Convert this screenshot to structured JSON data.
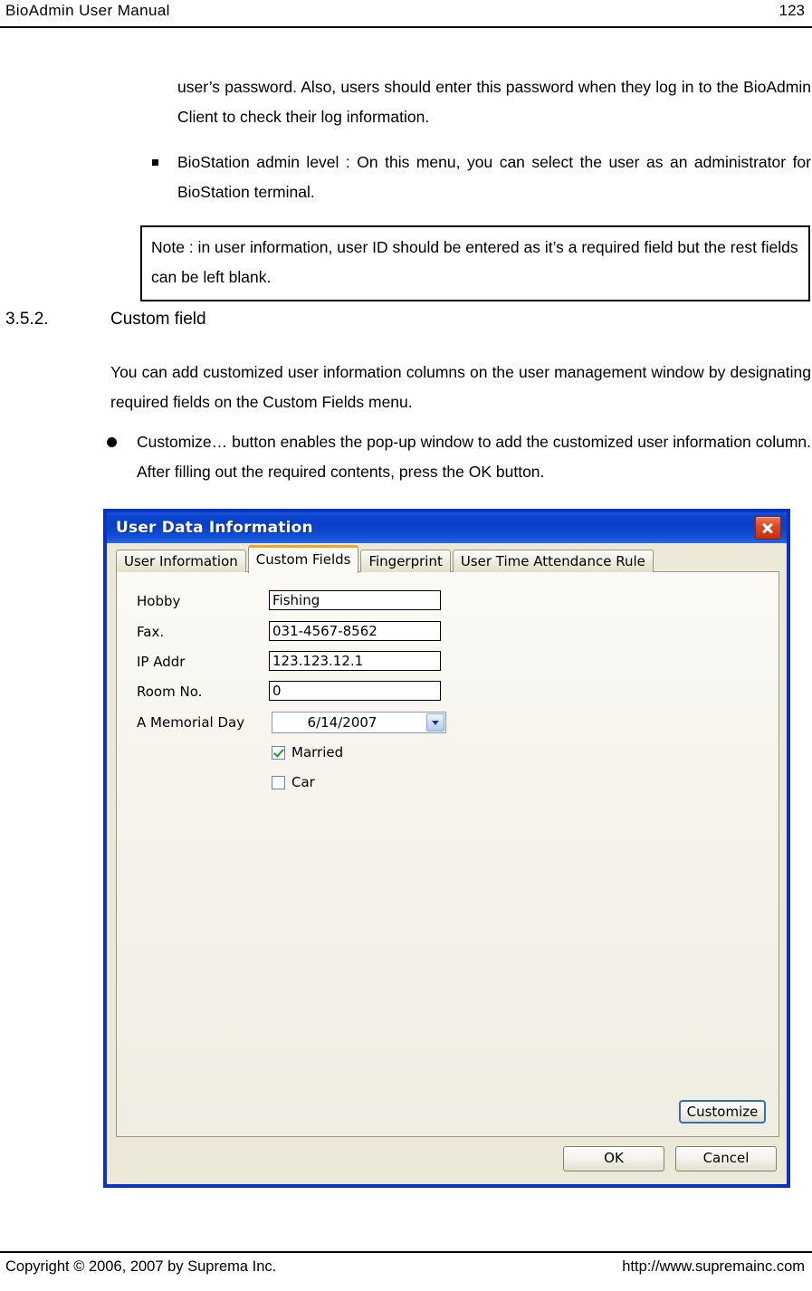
{
  "header": {
    "title": "BioAdmin  User  Manual",
    "page_number": "123"
  },
  "body": {
    "para_continuation": "user’s password. Also, users should enter this password when they log in to the BioAdmin Client to check their log information.",
    "bullet_biostation": "BioStation admin level : On this menu, you can select the user as an administrator for BioStation terminal.",
    "note": "Note : in user information, user ID should be entered as it’s a required field but the rest fields can be left blank.",
    "section_number": "3.5.2.",
    "section_title": "Custom field",
    "para_custom": "You can add customized user information columns on the user management window by designating required fields on the Custom Fields menu.",
    "bullet_customize": "Customize… button enables the pop-up window to add the customized user information column. After filling out the required contents, press the OK button."
  },
  "dialog": {
    "title": "User Data Information",
    "close_label": "×",
    "tabs": [
      {
        "label": "User Information",
        "active": false
      },
      {
        "label": "Custom Fields",
        "active": true
      },
      {
        "label": "Fingerprint",
        "active": false
      },
      {
        "label": "User Time Attendance Rule",
        "active": false
      }
    ],
    "fields": [
      {
        "label": "Hobby",
        "value": "Fishing"
      },
      {
        "label": "Fax.",
        "value": "031-4567-8562"
      },
      {
        "label": "IP Addr",
        "value": "123.123.12.1"
      },
      {
        "label": "Room No.",
        "value": "0"
      }
    ],
    "date_field": {
      "label": "A Memorial Day",
      "value": "6/14/2007"
    },
    "checkboxes": [
      {
        "label": "Married",
        "checked": true
      },
      {
        "label": "Car",
        "checked": false
      }
    ],
    "buttons": {
      "customize": "Customize",
      "ok": "OK",
      "cancel": "Cancel"
    },
    "colors": {
      "title_bar": "#0a3fc6",
      "window_border": "#0a34c8",
      "active_tab_accent": "#f0a42a",
      "close_button": "#c62d0c",
      "check_mark": "#1a9a1a",
      "panel_face": "#ece9d8"
    }
  },
  "footer": {
    "copyright": "Copyright © 2006, 2007 by Suprema Inc.",
    "url": "http://www.supremainc.com"
  }
}
